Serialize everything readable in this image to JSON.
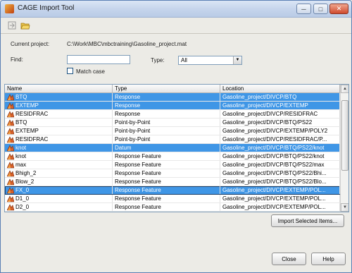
{
  "window": {
    "title": "CAGE Import Tool",
    "controls": [
      "minimize",
      "maximize",
      "close"
    ]
  },
  "toolbar": {
    "items": [
      {
        "icon": "import-icon"
      },
      {
        "icon": "folder-open-icon"
      }
    ]
  },
  "project": {
    "label": "Current project:",
    "path": "C:\\Work\\MBC\\mbctraining\\Gasoline_project.mat"
  },
  "find": {
    "label": "Find:",
    "value": ""
  },
  "type_filter": {
    "label": "Type:",
    "selected": "All"
  },
  "match_case": {
    "label": "Match case",
    "checked": false
  },
  "table": {
    "columns": [
      "Name",
      "Type",
      "Location"
    ],
    "rows": [
      {
        "name": "BTQ",
        "type": "Response",
        "location": "Gasoline_project/DIVCP/BTQ",
        "selected": true
      },
      {
        "name": "EXTEMP",
        "type": "Response",
        "location": "Gasoline_project/DIVCP/EXTEMP",
        "selected": true
      },
      {
        "name": "RESIDFRAC",
        "type": "Response",
        "location": "Gasoline_project/DIVCP/RESIDFRAC",
        "selected": false
      },
      {
        "name": "BTQ",
        "type": "Point-by-Point",
        "location": "Gasoline_project/DIVCP/BTQ/PS22",
        "selected": false
      },
      {
        "name": "EXTEMP",
        "type": "Point-by-Point",
        "location": "Gasoline_project/DIVCP/EXTEMP/POLY2",
        "selected": false
      },
      {
        "name": "RESIDFRAC",
        "type": "Point-by-Point",
        "location": "Gasoline_project/DIVCP/RESIDFRAC/P...",
        "selected": false
      },
      {
        "name": "knot",
        "type": "Datum",
        "location": "Gasoline_project/DIVCP/BTQ/PS22/knot",
        "selected": true
      },
      {
        "name": "knot",
        "type": "Response Feature",
        "location": "Gasoline_project/DIVCP/BTQ/PS22/knot",
        "selected": false
      },
      {
        "name": "max",
        "type": "Response Feature",
        "location": "Gasoline_project/DIVCP/BTQ/PS22/max",
        "selected": false
      },
      {
        "name": "Bhigh_2",
        "type": "Response Feature",
        "location": "Gasoline_project/DIVCP/BTQ/PS22/Bhi...",
        "selected": false
      },
      {
        "name": "Blow_2",
        "type": "Response Feature",
        "location": "Gasoline_project/DIVCP/BTQ/PS22/Blo...",
        "selected": false
      },
      {
        "name": "FX_0",
        "type": "Response Feature",
        "location": "Gasoline_project/DIVCP/EXTEMP/POL...",
        "selected": true,
        "focus": true
      },
      {
        "name": "D1_0",
        "type": "Response Feature",
        "location": "Gasoline_project/DIVCP/EXTEMP/POL...",
        "selected": false
      },
      {
        "name": "D2_0",
        "type": "Response Feature",
        "location": "Gasoline_project/DIVCP/EXTEMP/POL...",
        "selected": false
      }
    ]
  },
  "buttons": {
    "import_selected": "Import Selected Items...",
    "close": "Close",
    "help": "Help"
  },
  "colors": {
    "selection": "#3f96e6",
    "titlebar": "#c6d5ec"
  }
}
